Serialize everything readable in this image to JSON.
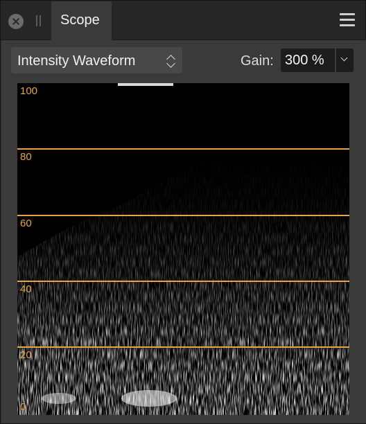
{
  "window": {
    "tab_title": "Scope",
    "close_icon": "close-icon",
    "grip_icon": "drag-grip-icon",
    "menu_icon": "hamburger-menu-icon"
  },
  "controls": {
    "mode": "Intensity Waveform",
    "gain_label": "Gain:",
    "gain_value": "300 %"
  },
  "scope": {
    "axis_labels": [
      "100",
      "80",
      "60",
      "40",
      "20",
      "0"
    ],
    "guide_levels": [
      80,
      60,
      40,
      20
    ],
    "guide_color": "#e8a44a"
  }
}
